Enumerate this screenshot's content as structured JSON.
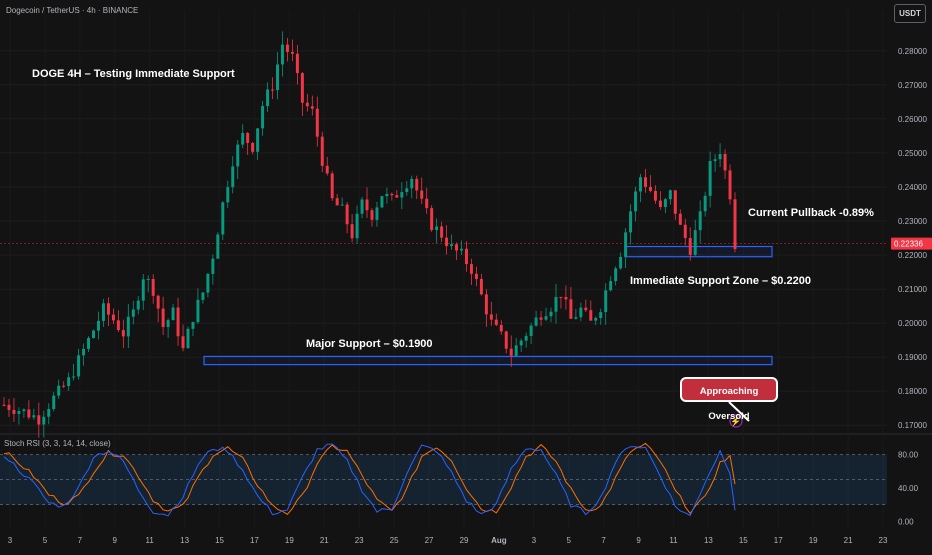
{
  "header": {
    "symbol_line": "Dogecoin / TetherUS · 4h · BINANCE",
    "currency_button": "USDT"
  },
  "annotations": {
    "title": "DOGE 4H – Testing Immediate Support",
    "pullback": "Current Pullback -0.89%",
    "immediate_support": "Immediate Support Zone – $0.2200",
    "major_support": "Major Support – $0.1900",
    "oversold": "Approaching Oversold"
  },
  "indicator": {
    "label": "Stoch RSI (3, 3, 14, 14, close)"
  },
  "colors": {
    "background": "#131313",
    "up_candle": "#089981",
    "down_candle": "#f23645",
    "zone_border": "#2962ff",
    "stoch_k": "#2962ff",
    "stoch_d": "#ff6d00",
    "price_tag": "#f23645",
    "badge": "#c32e3d"
  },
  "chart_data": [
    {
      "type": "candlestick",
      "pane": "price",
      "y_tick_labels": [
        "0.28000",
        "0.27000",
        "0.26000",
        "0.25000",
        "0.24000",
        "0.23000",
        "0.22000",
        "0.21000",
        "0.20000",
        "0.19000",
        "0.18000",
        "0.17000"
      ],
      "ylim": [
        0.168,
        0.292
      ],
      "current_price": "0.22336",
      "current_price_value": 0.22336,
      "x_tick_labels": [
        "3",
        "5",
        "7",
        "9",
        "11",
        "13",
        "15",
        "17",
        "19",
        "21",
        "23",
        "25",
        "27",
        "29",
        "Aug",
        "3",
        "5",
        "7",
        "9",
        "11",
        "13",
        "15",
        "17",
        "19",
        "21",
        "23"
      ],
      "zones": [
        {
          "label": "Immediate Support Zone – $0.2200",
          "low": 0.2195,
          "high": 0.2225
        },
        {
          "label": "Major Support – $0.1900",
          "low": 0.1878,
          "high": 0.1902
        }
      ],
      "close_path": [
        [
          0,
          0.176
        ],
        [
          4,
          0.174
        ],
        [
          7,
          0.172
        ],
        [
          10,
          0.178
        ],
        [
          13,
          0.183
        ],
        [
          16,
          0.192
        ],
        [
          18,
          0.198
        ],
        [
          20,
          0.204
        ],
        [
          22,
          0.201
        ],
        [
          24,
          0.197
        ],
        [
          26,
          0.203
        ],
        [
          28,
          0.214
        ],
        [
          30,
          0.21
        ],
        [
          32,
          0.199
        ],
        [
          34,
          0.203
        ],
        [
          36,
          0.192
        ],
        [
          38,
          0.202
        ],
        [
          40,
          0.209
        ],
        [
          42,
          0.22
        ],
        [
          44,
          0.235
        ],
        [
          46,
          0.248
        ],
        [
          48,
          0.255
        ],
        [
          50,
          0.252
        ],
        [
          52,
          0.264
        ],
        [
          54,
          0.27
        ],
        [
          56,
          0.282
        ],
        [
          58,
          0.278
        ],
        [
          60,
          0.265
        ],
        [
          62,
          0.262
        ],
        [
          64,
          0.248
        ],
        [
          66,
          0.236
        ],
        [
          68,
          0.233
        ],
        [
          70,
          0.226
        ],
        [
          72,
          0.235
        ],
        [
          74,
          0.232
        ],
        [
          76,
          0.238
        ],
        [
          78,
          0.236
        ],
        [
          80,
          0.24
        ],
        [
          82,
          0.243
        ],
        [
          84,
          0.235
        ],
        [
          86,
          0.229
        ],
        [
          88,
          0.226
        ],
        [
          90,
          0.222
        ],
        [
          92,
          0.22
        ],
        [
          94,
          0.216
        ],
        [
          96,
          0.208
        ],
        [
          98,
          0.2
        ],
        [
          100,
          0.196
        ],
        [
          102,
          0.191
        ],
        [
          104,
          0.195
        ],
        [
          106,
          0.199
        ],
        [
          108,
          0.203
        ],
        [
          110,
          0.205
        ],
        [
          112,
          0.209
        ],
        [
          114,
          0.201
        ],
        [
          116,
          0.204
        ],
        [
          118,
          0.2
        ],
        [
          120,
          0.205
        ],
        [
          122,
          0.214
        ],
        [
          124,
          0.221
        ],
        [
          126,
          0.233
        ],
        [
          128,
          0.243
        ],
        [
          130,
          0.239
        ],
        [
          132,
          0.233
        ],
        [
          134,
          0.238
        ],
        [
          136,
          0.228
        ],
        [
          138,
          0.222
        ],
        [
          140,
          0.231
        ],
        [
          142,
          0.246
        ],
        [
          144,
          0.251
        ],
        [
          146,
          0.238
        ],
        [
          147,
          0.2234
        ]
      ]
    },
    {
      "type": "line",
      "pane": "indicator",
      "name": "Stoch RSI (3, 3, 14, 14, close)",
      "y_tick_labels": [
        "80.00",
        "40.00",
        "0.00"
      ],
      "ylim": [
        -8,
        100
      ],
      "band": [
        20,
        80
      ],
      "midline": 50,
      "k_path": [
        [
          0,
          80
        ],
        [
          3,
          62
        ],
        [
          6,
          45
        ],
        [
          9,
          22
        ],
        [
          12,
          18
        ],
        [
          15,
          40
        ],
        [
          18,
          78
        ],
        [
          21,
          85
        ],
        [
          24,
          72
        ],
        [
          27,
          38
        ],
        [
          30,
          12
        ],
        [
          33,
          8
        ],
        [
          36,
          30
        ],
        [
          39,
          68
        ],
        [
          42,
          88
        ],
        [
          45,
          85
        ],
        [
          48,
          62
        ],
        [
          51,
          30
        ],
        [
          54,
          10
        ],
        [
          57,
          14
        ],
        [
          60,
          52
        ],
        [
          63,
          86
        ],
        [
          66,
          92
        ],
        [
          69,
          72
        ],
        [
          72,
          38
        ],
        [
          75,
          12
        ],
        [
          78,
          15
        ],
        [
          81,
          58
        ],
        [
          84,
          90
        ],
        [
          87,
          85
        ],
        [
          90,
          58
        ],
        [
          93,
          25
        ],
        [
          96,
          8
        ],
        [
          99,
          20
        ],
        [
          102,
          62
        ],
        [
          105,
          88
        ],
        [
          108,
          86
        ],
        [
          111,
          55
        ],
        [
          114,
          20
        ],
        [
          117,
          10
        ],
        [
          120,
          28
        ],
        [
          123,
          72
        ],
        [
          126,
          92
        ],
        [
          129,
          88
        ],
        [
          132,
          55
        ],
        [
          135,
          18
        ],
        [
          138,
          6
        ],
        [
          141,
          48
        ],
        [
          144,
          84
        ],
        [
          146,
          60
        ],
        [
          147,
          15
        ]
      ],
      "d_path": [
        [
          0,
          84
        ],
        [
          3,
          70
        ],
        [
          6,
          54
        ],
        [
          9,
          32
        ],
        [
          12,
          22
        ],
        [
          15,
          30
        ],
        [
          18,
          60
        ],
        [
          21,
          82
        ],
        [
          24,
          80
        ],
        [
          27,
          55
        ],
        [
          30,
          26
        ],
        [
          33,
          12
        ],
        [
          36,
          18
        ],
        [
          39,
          52
        ],
        [
          42,
          80
        ],
        [
          45,
          88
        ],
        [
          48,
          74
        ],
        [
          51,
          44
        ],
        [
          54,
          18
        ],
        [
          57,
          10
        ],
        [
          60,
          30
        ],
        [
          63,
          70
        ],
        [
          66,
          90
        ],
        [
          69,
          84
        ],
        [
          72,
          55
        ],
        [
          75,
          25
        ],
        [
          78,
          12
        ],
        [
          81,
          38
        ],
        [
          84,
          78
        ],
        [
          87,
          90
        ],
        [
          90,
          74
        ],
        [
          93,
          40
        ],
        [
          96,
          15
        ],
        [
          99,
          12
        ],
        [
          102,
          42
        ],
        [
          105,
          78
        ],
        [
          108,
          90
        ],
        [
          111,
          72
        ],
        [
          114,
          38
        ],
        [
          117,
          14
        ],
        [
          120,
          18
        ],
        [
          123,
          52
        ],
        [
          126,
          84
        ],
        [
          129,
          92
        ],
        [
          132,
          72
        ],
        [
          135,
          36
        ],
        [
          138,
          12
        ],
        [
          141,
          28
        ],
        [
          144,
          70
        ],
        [
          146,
          78
        ],
        [
          147,
          42
        ]
      ]
    }
  ]
}
